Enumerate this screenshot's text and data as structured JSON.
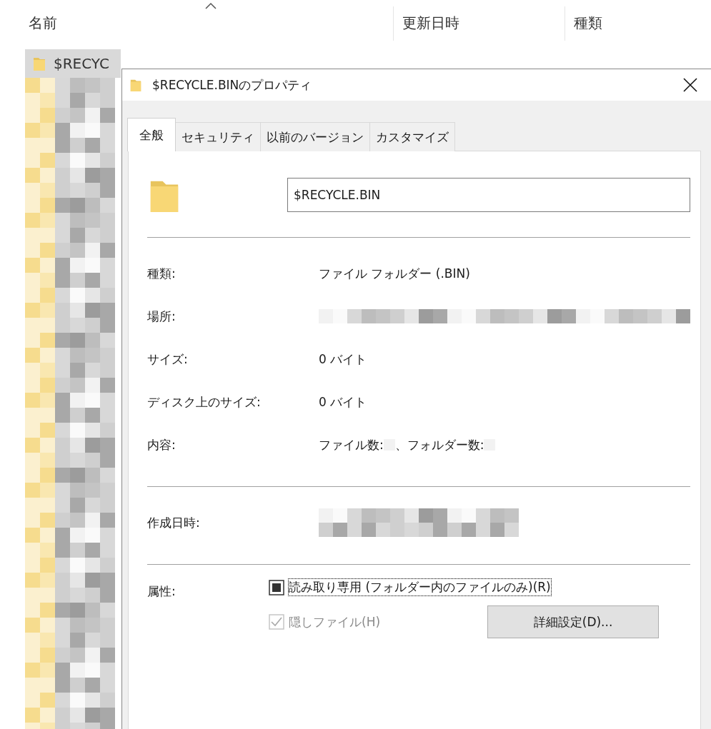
{
  "explorer": {
    "columns": [
      {
        "label": "名前",
        "sorted": true
      },
      {
        "label": "更新日時",
        "sorted": false
      },
      {
        "label": "種類",
        "sorted": false
      }
    ],
    "rows": [
      {
        "name": "$RECYC",
        "selected": true
      }
    ]
  },
  "dialog": {
    "title": "$RECYCLE.BINのプロパティ",
    "tabs": [
      {
        "label": "全般",
        "selected": true
      },
      {
        "label": "セキュリティ",
        "selected": false
      },
      {
        "label": "以前のバージョン",
        "selected": false
      },
      {
        "label": "カスタマイズ",
        "selected": false
      }
    ],
    "name_field": {
      "value": "$RECYCLE.BIN"
    },
    "properties": [
      {
        "label": "種類:",
        "kind": "text",
        "value": "ファイル フォルダー (.BIN)"
      },
      {
        "label": "場所:",
        "kind": "redacted"
      },
      {
        "label": "サイズ:",
        "kind": "text",
        "value": "0 バイト"
      },
      {
        "label": "ディスク上のサイズ:",
        "kind": "text",
        "value": "0 バイト"
      },
      {
        "label": "内容:",
        "kind": "counts",
        "parts": [
          "ファイル数:",
          "、フォルダー数:"
        ]
      }
    ],
    "dates": [
      {
        "label": "作成日時:",
        "kind": "redacted"
      }
    ],
    "attributes": {
      "label": "属性:",
      "read_only": {
        "label": "読み取り専用 (フォルダー内のファイルのみ)(R)",
        "indeterminate": true,
        "focused": true
      },
      "hidden": {
        "label": "隠しファイル(H)",
        "checked": true,
        "disabled": true
      },
      "advanced_button": "詳細設定(D)..."
    }
  }
}
